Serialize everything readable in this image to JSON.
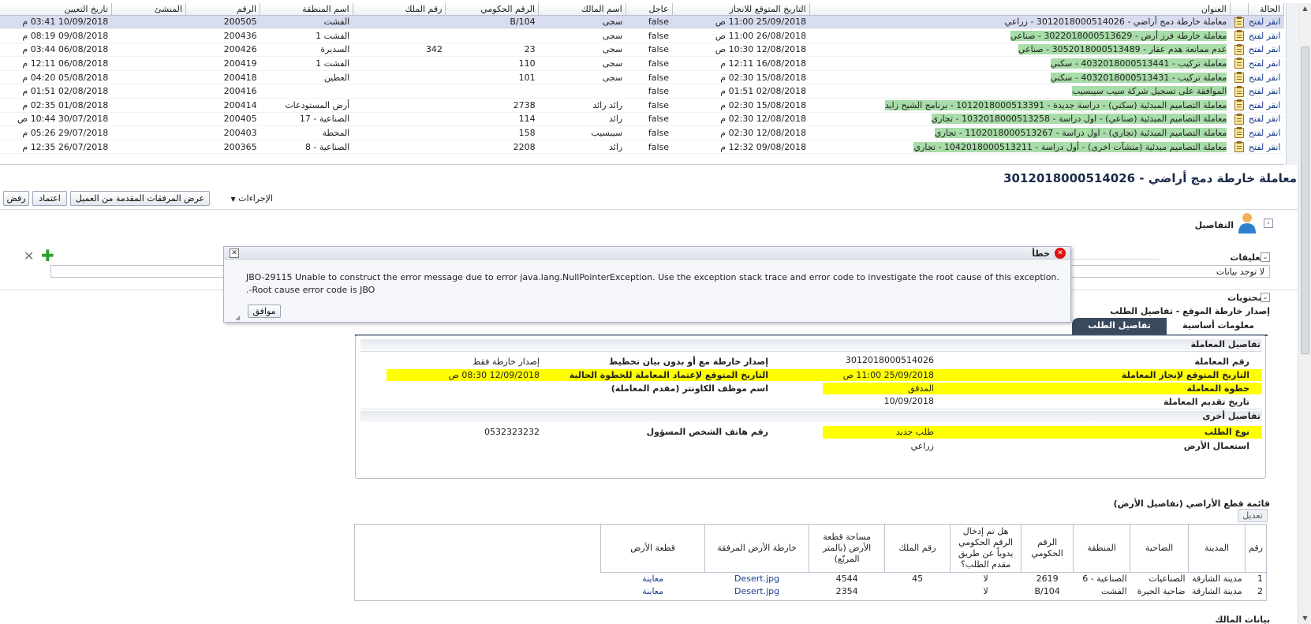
{
  "top_table": {
    "headers": [
      "الحالة",
      "العنوان",
      "التاريخ المتوقع للانجاز",
      "عاجل",
      "اسم المالك",
      "الرقم الحكومي",
      "رقم الملك",
      "اسم المنطقة",
      "الرقم",
      "المنشئ",
      "تاريخ التعيين"
    ],
    "rows": [
      {
        "state": "انقر لفتح",
        "title": "معاملة خارطة دمج أراضي - 3012018000514026 - زراعي",
        "due": "25/09/2018 11:00 ص",
        "urgent": "false",
        "owner": "سجى",
        "gov": "B/104",
        "plot": "",
        "area": "الفشت",
        "num": "200505",
        "creator": "",
        "assigned": "10/09/2018 03:41 م"
      },
      {
        "state": "انقر لفتح",
        "title": "معاملة خارطة فرز أرض - 3022018000513629 - صناعي",
        "due": "26/08/2018 11:00 ص",
        "urgent": "false",
        "owner": "سجى",
        "gov": "",
        "plot": "",
        "area": "الفشت 1",
        "num": "200436",
        "creator": "",
        "assigned": "09/08/2018 08:19 م"
      },
      {
        "state": "انقر لفتح",
        "title": "عدم ممانعة هدم عقار - 3052018000513489 - صناعي",
        "due": "12/08/2018 10:30 ص",
        "urgent": "false",
        "owner": "سجى",
        "gov": "23",
        "plot": "342",
        "area": "السديرة",
        "num": "200426",
        "creator": "",
        "assigned": "06/08/2018 03:44 م"
      },
      {
        "state": "انقر لفتح",
        "title": "معاملة تركيب - 4032018000513441 - سكني",
        "due": "16/08/2018 12:11 م",
        "urgent": "false",
        "owner": "سجى",
        "gov": "110",
        "plot": "",
        "area": "الفشت 1",
        "num": "200419",
        "creator": "",
        "assigned": "06/08/2018 12:11 م"
      },
      {
        "state": "انقر لفتح",
        "title": "معاملة تركيب - 4032018000513431 - سكني",
        "due": "15/08/2018 02:30 م",
        "urgent": "false",
        "owner": "سجى",
        "gov": "101",
        "plot": "",
        "area": "العطين",
        "num": "200418",
        "creator": "",
        "assigned": "05/08/2018 04:20 م"
      },
      {
        "state": "انقر لفتح",
        "title": "الموافقة على تسجيل شركة سيب سيبسيب",
        "due": "02/08/2018 01:51 م",
        "urgent": "false",
        "owner": "",
        "gov": "",
        "plot": "",
        "area": "",
        "num": "200416",
        "creator": "",
        "assigned": "02/08/2018 01:51 م"
      },
      {
        "state": "انقر لفتح",
        "title": "معاملة التصاميم المبدئية (سكني) - دراسة جديدة - 1012018000513391 - برنامج الشيخ زايد",
        "due": "15/08/2018 02:30 م",
        "urgent": "false",
        "owner": "رائد رائد",
        "gov": "2738",
        "plot": "",
        "area": "أرض المستودعات",
        "num": "200414",
        "creator": "",
        "assigned": "01/08/2018 02:35 م"
      },
      {
        "state": "انقر لفتح",
        "title": "معاملة التصاميم المبدئية (صناعي) - اول دراسة - 1032018000513258 - تجاري",
        "due": "12/08/2018 02:30 م",
        "urgent": "false",
        "owner": "رائد",
        "gov": "114",
        "plot": "",
        "area": "الصناعية - 17",
        "num": "200405",
        "creator": "",
        "assigned": "30/07/2018 10:44 ص"
      },
      {
        "state": "انقر لفتح",
        "title": "معاملة التصاميم المبدئية (تجاري) - اول دراسة - 1102018000513267 - تجاري",
        "due": "12/08/2018 02:30 م",
        "urgent": "false",
        "owner": "سيبسيب",
        "gov": "158",
        "plot": "",
        "area": "المحطة",
        "num": "200403",
        "creator": "",
        "assigned": "29/07/2018 05:26 م"
      },
      {
        "state": "انقر لفتح",
        "title": "معاملة التصاميم مبدئية (منشآت اخرى) - أول دراسة - 1042018000513211 - تجاري",
        "due": "09/08/2018 12:32 م",
        "urgent": "false",
        "owner": "رائد",
        "gov": "2208",
        "plot": "",
        "area": "الصناعية - 8",
        "num": "200365",
        "creator": "",
        "assigned": "26/07/2018 12:35 م"
      }
    ]
  },
  "page_title": "معاملة خارطة دمج أراضي - 3012018000514026",
  "toolbar": {
    "reject": "رفض",
    "approve": "اعتماد",
    "attachments": "عرض المرفقات المقدمة من العميل",
    "actions": "الإجراءات"
  },
  "sections": {
    "details": "التفاصيل",
    "comments": "التعليقات",
    "no_data": "لا توجد بيانات",
    "contents": "المحتويات",
    "issue_subtitle": "إصدار خارطة الموقع - تفاصيل الطلب"
  },
  "dialog": {
    "title": "خطأ",
    "message": "JBO-29115 Unable to construct the error message due to error java.lang.NullPointerException. Use the exception stack trace and error code to investigate the root cause of this exception. Root cause error code is JBO-.",
    "ok": "موافق"
  },
  "tabs": {
    "basic": "معلومات أساسية",
    "request": "تفاصيل الطلب"
  },
  "tx_details": {
    "heading": "تفاصيل المعاملة",
    "tx_no_label": "رقم المعاملة",
    "tx_no": "3012018000514026",
    "issue_label": "إصدار خارطة مع أو بدون بيان تخطيط",
    "issue_value": "إصدار خارطة فقط",
    "due_label": "التاريخ المتوقع لإنجاز المعاملة",
    "due_value": "25/09/2018 11:00 ص",
    "step_due_label": "التاريخ المتوقع لإعتماد المعاملة للخطوة الحالية",
    "step_due_value": "12/09/2018 08:30 ص",
    "step_label": "خطوة المعاملة",
    "step_value": "المدقق",
    "counter_label": "اسم موظف الكاونتر (مقدم المعاملة)",
    "submit_label": "تاريخ تقديم المعاملة",
    "submit_value": "10/09/2018"
  },
  "other_details": {
    "heading": "تفاصيل أخرى",
    "type_label": "نوع الطلب",
    "type_value": "طلب جديد",
    "phone_label": "رقم هاتف الشخص المسؤول",
    "phone_value": "0532323232",
    "use_label": "استعمال الأرض",
    "use_value": "زراعي"
  },
  "land": {
    "heading": "قائمة قطع الأراضي (تفاصيل الأرض)",
    "edit": "تعديل",
    "headers": [
      "رقم",
      "المدينة",
      "الضاحية",
      "المنطقة",
      "الرقم الحكومي",
      "هل تم إدخال الرقم الحكومي يدوياً عن طريق مقدم الطلب؟",
      "رقم الملك",
      "مساحة قطعة الأرض (بالمتر المربّع)",
      "خارطة الأرض المرفقة",
      "قطعة الأرض"
    ],
    "rows": [
      [
        "1",
        "مدينة الشارقة",
        "الصناعيات",
        "الصناعية - 6",
        "2619",
        "لا",
        "45",
        "4544",
        "Desert.jpg",
        "معاينة"
      ],
      [
        "2",
        "مدينة الشارقة",
        "ضاحية الحيرة",
        "الفشت",
        "B/104",
        "لا",
        "",
        "2354",
        "Desert.jpg",
        "معاينة"
      ]
    ]
  },
  "owner_heading": "بيانات المالك"
}
